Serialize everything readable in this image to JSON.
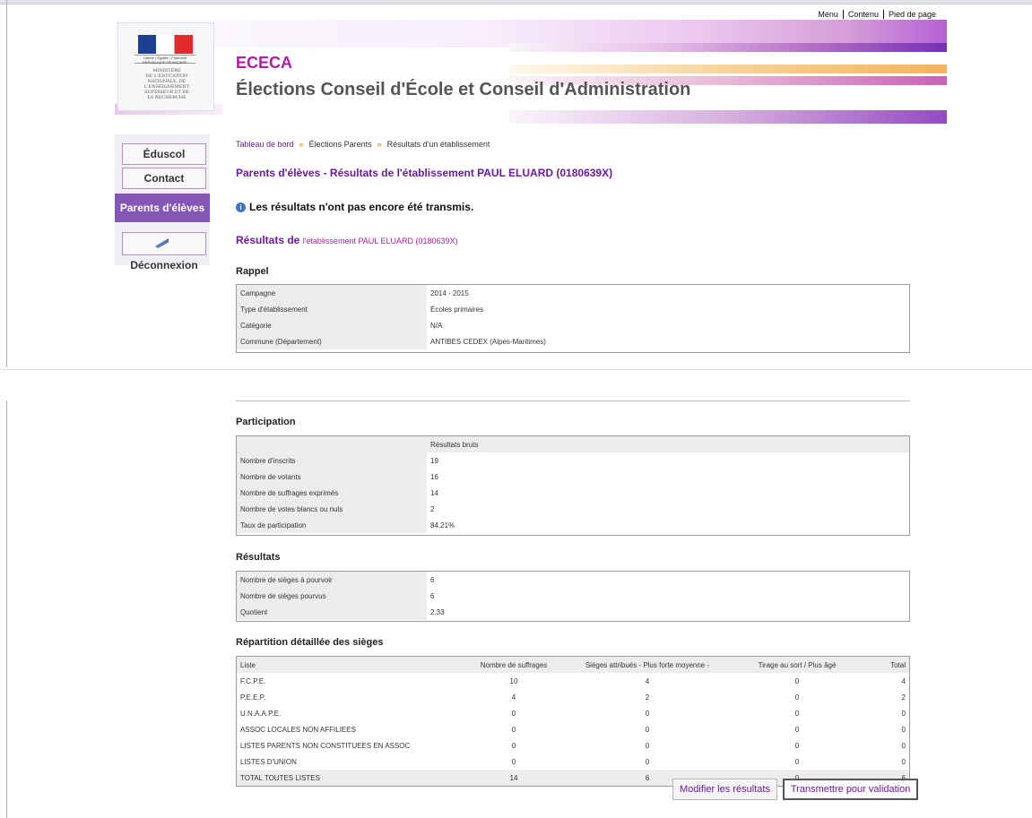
{
  "utility_nav": [
    "Menu",
    "Contenu",
    "Pied de page"
  ],
  "app": {
    "title": "ECECA",
    "subtitle": "Élections Conseil d'École et Conseil d'Administration",
    "logo_text": [
      "Liberté • Égalité • Fraternité",
      "RÉPUBLIQUE FRANÇAISE"
    ],
    "ministry": [
      "MINISTÈRE",
      "DE L'ÉDUCATION",
      "NATIONALE, DE",
      "L'ENSEIGNEMENT",
      "SUPÉRIEUR ET DE",
      "LA RECHERCHE"
    ]
  },
  "sidebar": {
    "items": [
      {
        "label": "Éduscol"
      },
      {
        "label": "Contact"
      },
      {
        "label": "Parents d'élèves"
      },
      {
        "label": "Déconnexion"
      }
    ]
  },
  "breadcrumb": [
    "Tableau de bord",
    "Élections Parents",
    "Résultats d'un établissement"
  ],
  "page": {
    "heading": "Parents d'élèves - Résultats de l'établissement PAUL ELUARD (0180639X)",
    "notice": "Les résultats n'ont pas encore été transmis.",
    "results_prefix": "Résultats de",
    "results_target": "l'établissement PAUL ELUARD (0180639X)"
  },
  "rappel": {
    "title": "Rappel",
    "rows": [
      [
        "Campagne",
        "2014 - 2015"
      ],
      [
        "Type d'établissement",
        "Écoles primaires"
      ],
      [
        "Catégorie",
        "N/A"
      ],
      [
        "Commune (Département)",
        "ANTIBES CEDEX (Alpes-Maritimes)"
      ]
    ]
  },
  "participation": {
    "title": "Participation",
    "column": "Résultats bruts",
    "rows": [
      [
        "Nombre d'inscrits",
        "19"
      ],
      [
        "Nombre de votants",
        "16"
      ],
      [
        "Nombre de suffrages exprimés",
        "14"
      ],
      [
        "Nombre de votes blancs ou nuls",
        "2"
      ],
      [
        "Taux de participation",
        "84.21%"
      ]
    ]
  },
  "resultats": {
    "title": "Résultats",
    "rows": [
      [
        "Nombre de sièges à pourvoir",
        "6"
      ],
      [
        "Nombre de sièges pourvus",
        "6"
      ],
      [
        "Quotient",
        "2.33"
      ]
    ]
  },
  "repartition": {
    "title": "Répartition détaillée des sièges",
    "headers": [
      "Liste",
      "Nombre de suffrages",
      "Sièges attribués - Plus forte moyenne -",
      "Tirage au sort / Plus âgé",
      "Total"
    ],
    "rows": [
      [
        "F.C.P.E.",
        "10",
        "4",
        "0",
        "4"
      ],
      [
        "P.E.E.P.",
        "4",
        "2",
        "0",
        "2"
      ],
      [
        "U.N.A.A.P.E.",
        "0",
        "0",
        "0",
        "0"
      ],
      [
        "ASSOC LOCALES NON AFFILIEES",
        "0",
        "0",
        "0",
        "0"
      ],
      [
        "LISTES PARENTS NON CONSTITUEES EN ASSOC",
        "0",
        "0",
        "0",
        "0"
      ],
      [
        "LISTES D'UNION",
        "0",
        "0",
        "0",
        "0"
      ],
      [
        "TOTAL TOUTES LISTES",
        "14",
        "6",
        "0",
        "6"
      ]
    ]
  },
  "actions": {
    "modify": "Modifier les résultats",
    "transmit": "Transmettre pour validation"
  },
  "colors": {
    "accent": "#b01ca3",
    "link": "#6b1a9f",
    "active_nav": "#8456b5",
    "separator": "#e39a34"
  }
}
